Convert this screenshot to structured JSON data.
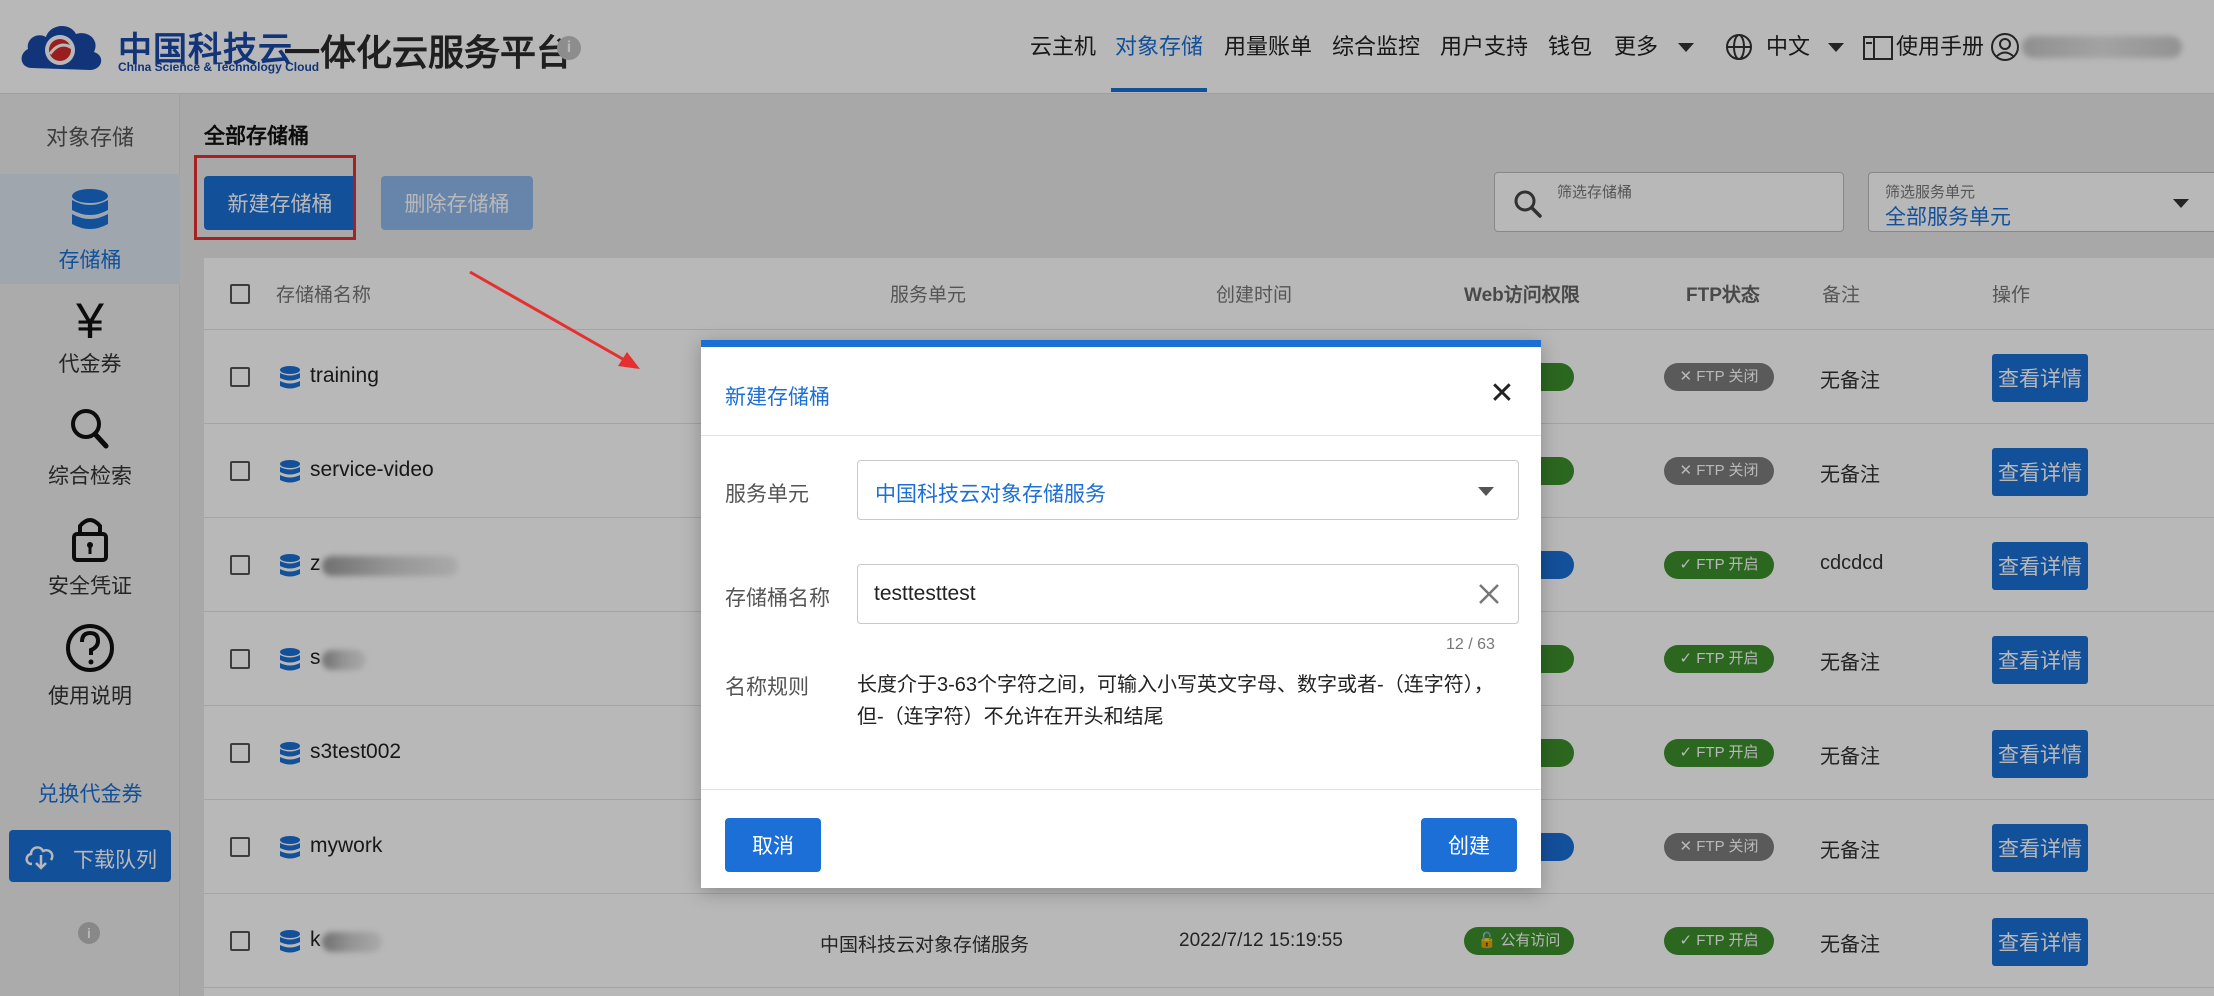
{
  "header": {
    "brand_cn": "中国科技云",
    "brand_en": "China Science & Technology Cloud",
    "platform_title": "一体化云服务平台",
    "info_glyph": "i",
    "nav": [
      {
        "label": "云主机",
        "active": false
      },
      {
        "label": "对象存储",
        "active": true
      },
      {
        "label": "用量账单",
        "active": false
      },
      {
        "label": "综合监控",
        "active": false
      },
      {
        "label": "用户支持",
        "active": false
      },
      {
        "label": "钱包",
        "active": false
      },
      {
        "label": "更多",
        "active": false
      }
    ],
    "language": "中文",
    "manual": "使用手册",
    "icons": {
      "language": "globe-icon",
      "manual": "book-icon",
      "user": "user-icon"
    }
  },
  "sidebar": {
    "title": "对象存储",
    "items": [
      {
        "label": "存储桶",
        "icon": "database-icon",
        "active": true
      },
      {
        "label": "代金券",
        "icon": "yen-icon",
        "active": false
      },
      {
        "label": "综合检索",
        "icon": "search-icon",
        "active": false
      },
      {
        "label": "安全凭证",
        "icon": "lock-icon",
        "active": false
      },
      {
        "label": "使用说明",
        "icon": "help-icon",
        "active": false
      }
    ],
    "redeem_link": "兑换代金券",
    "download_queue": "下载队列",
    "info_glyph": "i"
  },
  "main": {
    "title": "全部存储桶",
    "new_bucket_button": "新建存储桶",
    "delete_bucket_button": "删除存储桶",
    "search_label": "筛选存储桶",
    "unit_filter_label": "筛选服务单元",
    "unit_filter_value": "全部服务单元",
    "columns": [
      "存储桶名称",
      "服务单元",
      "创建时间",
      "Web访问权限",
      "FTP状态",
      "备注",
      "操作"
    ],
    "rows": [
      {
        "name": "training",
        "unit": "",
        "time": "",
        "web": "问",
        "web_color": "#3d8f2d",
        "ftp": "FTP 关闭",
        "ftp_glyph": "✕",
        "ftp_state": "off",
        "remark": "无备注",
        "action": "查看详情"
      },
      {
        "name": "service-video",
        "unit": "",
        "time": "",
        "web": "问",
        "web_color": "#3d8f2d",
        "ftp": "FTP 关闭",
        "ftp_glyph": "✕",
        "ftp_state": "off",
        "remark": "无备注",
        "action": "查看详情"
      },
      {
        "name": "z",
        "unit": "",
        "time": "",
        "web": "问",
        "web_color": "#1b6fd6",
        "ftp": "FTP 开启",
        "ftp_glyph": "✓",
        "ftp_state": "on",
        "remark": "cdcdcd",
        "action": "查看详情"
      },
      {
        "name": "s",
        "unit": "",
        "time": "",
        "web": "问",
        "web_color": "#3d8f2d",
        "ftp": "FTP 开启",
        "ftp_glyph": "✓",
        "ftp_state": "on",
        "remark": "无备注",
        "action": "查看详情"
      },
      {
        "name": "s3test002",
        "unit": "",
        "time": "",
        "web": "问",
        "web_color": "#3d8f2d",
        "ftp": "FTP 开启",
        "ftp_glyph": "✓",
        "ftp_state": "on",
        "remark": "无备注",
        "action": "查看详情"
      },
      {
        "name": "mywork",
        "unit": "",
        "time": "",
        "web": "问",
        "web_color": "#1b6fd6",
        "ftp": "FTP 关闭",
        "ftp_glyph": "✕",
        "ftp_state": "off",
        "remark": "无备注",
        "action": "查看详情"
      },
      {
        "name": "k",
        "unit": "中国科技云对象存储服务",
        "time": "2022/7/12 15:19:55",
        "web": "公有访问",
        "web_color": "#3d8f2d",
        "ftp": "FTP 开启",
        "ftp_glyph": "✓",
        "ftp_state": "on",
        "remark": "无备注",
        "action": "查看详情"
      }
    ]
  },
  "modal": {
    "title": "新建存储桶",
    "close_glyph": "✕",
    "service_unit_label": "服务单元",
    "service_unit_value": "中国科技云对象存储服务",
    "bucket_name_label": "存储桶名称",
    "bucket_name_value": "testtesttest",
    "char_count": "12 / 63",
    "rule_label": "名称规则",
    "rule_text": "长度介于3-63个字符之间，可输入小写英文字母、数字或者-（连字符），但-（连字符）不允许在开头和结尾",
    "cancel_button": "取消",
    "create_button": "创建"
  },
  "colors": {
    "accent": "#1b6fd6",
    "green": "#3d8f2d",
    "gray": "#7d7d7d",
    "highlight": "#e63030"
  }
}
